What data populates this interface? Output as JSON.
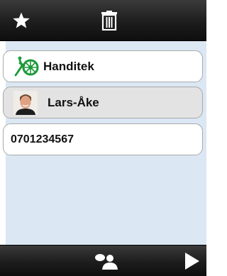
{
  "toolbar": {
    "favorite_icon": "star-icon",
    "delete_icon": "trash-icon"
  },
  "contact_list": {
    "company": {
      "label": "Handitek",
      "logo": "handitek-logo-icon",
      "logo_color": "#1b9a3a"
    },
    "contact": {
      "label": "Lars-Åke",
      "avatar": "person-photo"
    },
    "phone": {
      "label": "0701234567"
    }
  },
  "bottom_bar": {
    "contacts_icon": "people-icon",
    "next_icon": "play-right-icon"
  },
  "colors": {
    "bar": "#1d1d1d",
    "panel": "#dbe7f3",
    "selected_row": "#e3e3e3"
  }
}
